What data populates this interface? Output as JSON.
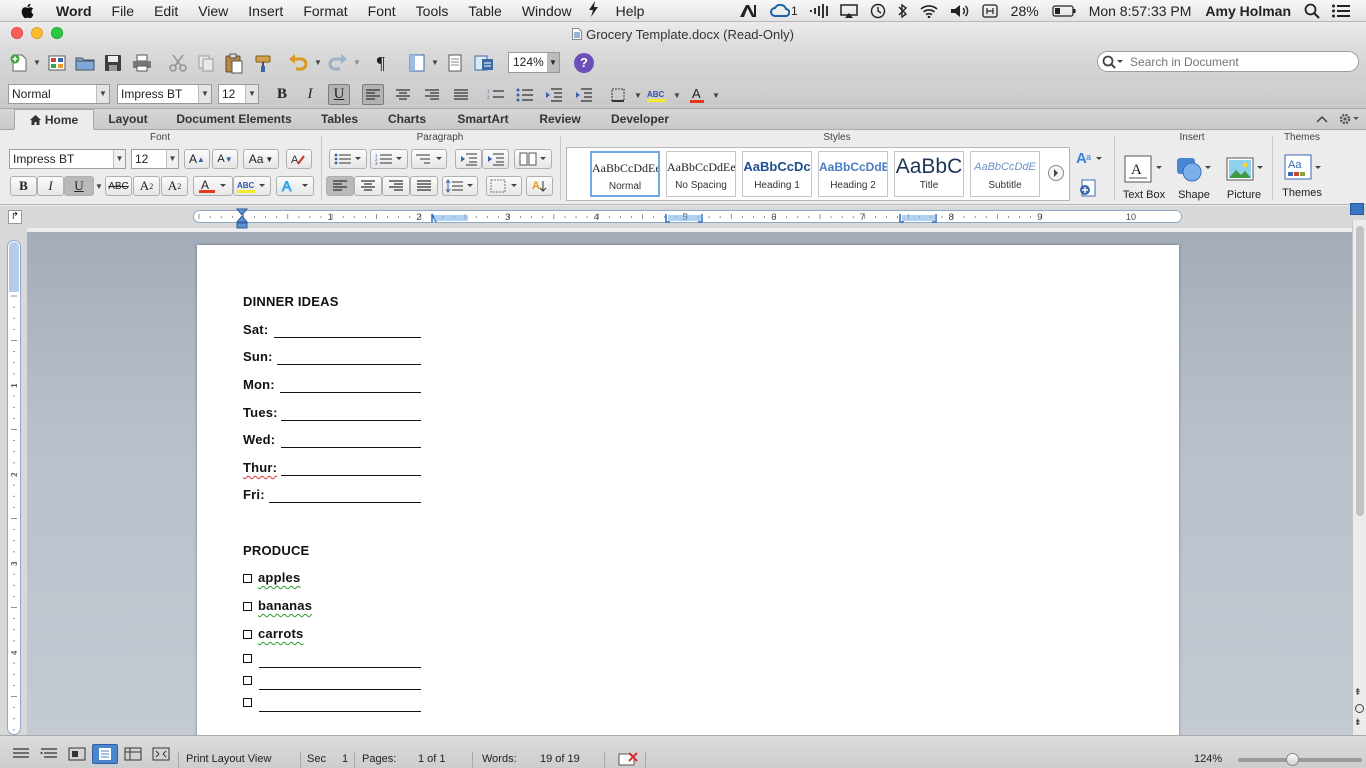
{
  "menubar": {
    "items": [
      "Word",
      "File",
      "Edit",
      "View",
      "Insert",
      "Format",
      "Font",
      "Tools",
      "Table",
      "Window",
      "Help"
    ],
    "status_badge_count": "1",
    "battery": "28%",
    "clock": "Mon 8:57:33 PM",
    "user": "Amy Holman"
  },
  "window": {
    "title": "Grocery Template.docx (Read-Only)"
  },
  "toolbar": {
    "zoom": "124%",
    "search_placeholder": "Search in Document",
    "paragraph_mark": "¶",
    "help": "?"
  },
  "format_bar": {
    "style": "Normal",
    "font": "Impress BT",
    "size": "12"
  },
  "ribbon": {
    "tabs": [
      "Home",
      "Layout",
      "Document Elements",
      "Tables",
      "Charts",
      "SmartArt",
      "Review",
      "Developer"
    ],
    "groups": {
      "font": "Font",
      "paragraph": "Paragraph",
      "styles": "Styles",
      "insert": "Insert",
      "themes": "Themes"
    },
    "font_name": "Impress BT",
    "font_size": "12",
    "styles": [
      {
        "preview": "AaBbCcDdEe",
        "name": "Normal"
      },
      {
        "preview": "AaBbCcDdEe",
        "name": "No Spacing"
      },
      {
        "preview": "AaBbCcDc",
        "name": "Heading 1"
      },
      {
        "preview": "AaBbCcDdEe",
        "name": "Heading 2"
      },
      {
        "preview": "AaBbC",
        "name": "Title"
      },
      {
        "preview": "AaBbCcDdE",
        "name": "Subtitle"
      }
    ],
    "insert": {
      "text_box": "Text Box",
      "shape": "Shape",
      "picture": "Picture"
    },
    "themes": "Themes"
  },
  "ruler": {
    "h_numbers": [
      "1",
      "2",
      "3",
      "4",
      "5",
      "6",
      "7",
      "8",
      "9",
      "10"
    ],
    "v_numbers": [
      "1",
      "2",
      "3",
      "4"
    ]
  },
  "document": {
    "heading1": "DINNER IDEAS",
    "days": [
      "Sat:",
      "Sun:",
      "Mon:",
      "Tues:",
      "Wed:",
      "Thur:",
      "Fri:"
    ],
    "heading2": "PRODUCE",
    "produce": [
      "apples",
      "bananas",
      "carrots"
    ]
  },
  "statusbar": {
    "view": "Print Layout View",
    "sec_label": "Sec",
    "sec": "1",
    "pages_label": "Pages:",
    "pages": "1 of 1",
    "words_label": "Words:",
    "words": "19 of 19",
    "zoom": "124%"
  }
}
